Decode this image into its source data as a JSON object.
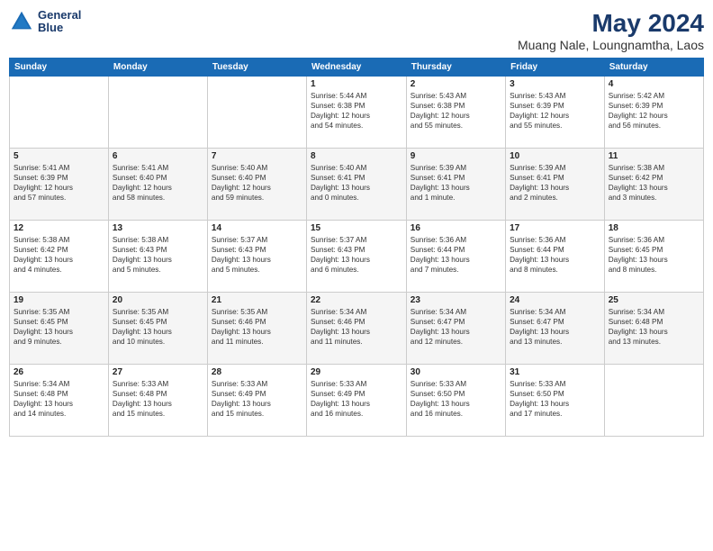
{
  "app": {
    "logo_line1": "General",
    "logo_line2": "Blue",
    "main_title": "May 2024",
    "subtitle": "Muang Nale, Loungnamtha, Laos"
  },
  "calendar": {
    "headers": [
      "Sunday",
      "Monday",
      "Tuesday",
      "Wednesday",
      "Thursday",
      "Friday",
      "Saturday"
    ],
    "weeks": [
      [
        {
          "day": "",
          "content": ""
        },
        {
          "day": "",
          "content": ""
        },
        {
          "day": "",
          "content": ""
        },
        {
          "day": "1",
          "content": "Sunrise: 5:44 AM\nSunset: 6:38 PM\nDaylight: 12 hours\nand 54 minutes."
        },
        {
          "day": "2",
          "content": "Sunrise: 5:43 AM\nSunset: 6:38 PM\nDaylight: 12 hours\nand 55 minutes."
        },
        {
          "day": "3",
          "content": "Sunrise: 5:43 AM\nSunset: 6:39 PM\nDaylight: 12 hours\nand 55 minutes."
        },
        {
          "day": "4",
          "content": "Sunrise: 5:42 AM\nSunset: 6:39 PM\nDaylight: 12 hours\nand 56 minutes."
        }
      ],
      [
        {
          "day": "5",
          "content": "Sunrise: 5:41 AM\nSunset: 6:39 PM\nDaylight: 12 hours\nand 57 minutes."
        },
        {
          "day": "6",
          "content": "Sunrise: 5:41 AM\nSunset: 6:40 PM\nDaylight: 12 hours\nand 58 minutes."
        },
        {
          "day": "7",
          "content": "Sunrise: 5:40 AM\nSunset: 6:40 PM\nDaylight: 12 hours\nand 59 minutes."
        },
        {
          "day": "8",
          "content": "Sunrise: 5:40 AM\nSunset: 6:41 PM\nDaylight: 13 hours\nand 0 minutes."
        },
        {
          "day": "9",
          "content": "Sunrise: 5:39 AM\nSunset: 6:41 PM\nDaylight: 13 hours\nand 1 minute."
        },
        {
          "day": "10",
          "content": "Sunrise: 5:39 AM\nSunset: 6:41 PM\nDaylight: 13 hours\nand 2 minutes."
        },
        {
          "day": "11",
          "content": "Sunrise: 5:38 AM\nSunset: 6:42 PM\nDaylight: 13 hours\nand 3 minutes."
        }
      ],
      [
        {
          "day": "12",
          "content": "Sunrise: 5:38 AM\nSunset: 6:42 PM\nDaylight: 13 hours\nand 4 minutes."
        },
        {
          "day": "13",
          "content": "Sunrise: 5:38 AM\nSunset: 6:43 PM\nDaylight: 13 hours\nand 5 minutes."
        },
        {
          "day": "14",
          "content": "Sunrise: 5:37 AM\nSunset: 6:43 PM\nDaylight: 13 hours\nand 5 minutes."
        },
        {
          "day": "15",
          "content": "Sunrise: 5:37 AM\nSunset: 6:43 PM\nDaylight: 13 hours\nand 6 minutes."
        },
        {
          "day": "16",
          "content": "Sunrise: 5:36 AM\nSunset: 6:44 PM\nDaylight: 13 hours\nand 7 minutes."
        },
        {
          "day": "17",
          "content": "Sunrise: 5:36 AM\nSunset: 6:44 PM\nDaylight: 13 hours\nand 8 minutes."
        },
        {
          "day": "18",
          "content": "Sunrise: 5:36 AM\nSunset: 6:45 PM\nDaylight: 13 hours\nand 8 minutes."
        }
      ],
      [
        {
          "day": "19",
          "content": "Sunrise: 5:35 AM\nSunset: 6:45 PM\nDaylight: 13 hours\nand 9 minutes."
        },
        {
          "day": "20",
          "content": "Sunrise: 5:35 AM\nSunset: 6:45 PM\nDaylight: 13 hours\nand 10 minutes."
        },
        {
          "day": "21",
          "content": "Sunrise: 5:35 AM\nSunset: 6:46 PM\nDaylight: 13 hours\nand 11 minutes."
        },
        {
          "day": "22",
          "content": "Sunrise: 5:34 AM\nSunset: 6:46 PM\nDaylight: 13 hours\nand 11 minutes."
        },
        {
          "day": "23",
          "content": "Sunrise: 5:34 AM\nSunset: 6:47 PM\nDaylight: 13 hours\nand 12 minutes."
        },
        {
          "day": "24",
          "content": "Sunrise: 5:34 AM\nSunset: 6:47 PM\nDaylight: 13 hours\nand 13 minutes."
        },
        {
          "day": "25",
          "content": "Sunrise: 5:34 AM\nSunset: 6:48 PM\nDaylight: 13 hours\nand 13 minutes."
        }
      ],
      [
        {
          "day": "26",
          "content": "Sunrise: 5:34 AM\nSunset: 6:48 PM\nDaylight: 13 hours\nand 14 minutes."
        },
        {
          "day": "27",
          "content": "Sunrise: 5:33 AM\nSunset: 6:48 PM\nDaylight: 13 hours\nand 15 minutes."
        },
        {
          "day": "28",
          "content": "Sunrise: 5:33 AM\nSunset: 6:49 PM\nDaylight: 13 hours\nand 15 minutes."
        },
        {
          "day": "29",
          "content": "Sunrise: 5:33 AM\nSunset: 6:49 PM\nDaylight: 13 hours\nand 16 minutes."
        },
        {
          "day": "30",
          "content": "Sunrise: 5:33 AM\nSunset: 6:50 PM\nDaylight: 13 hours\nand 16 minutes."
        },
        {
          "day": "31",
          "content": "Sunrise: 5:33 AM\nSunset: 6:50 PM\nDaylight: 13 hours\nand 17 minutes."
        },
        {
          "day": "",
          "content": ""
        }
      ]
    ]
  }
}
